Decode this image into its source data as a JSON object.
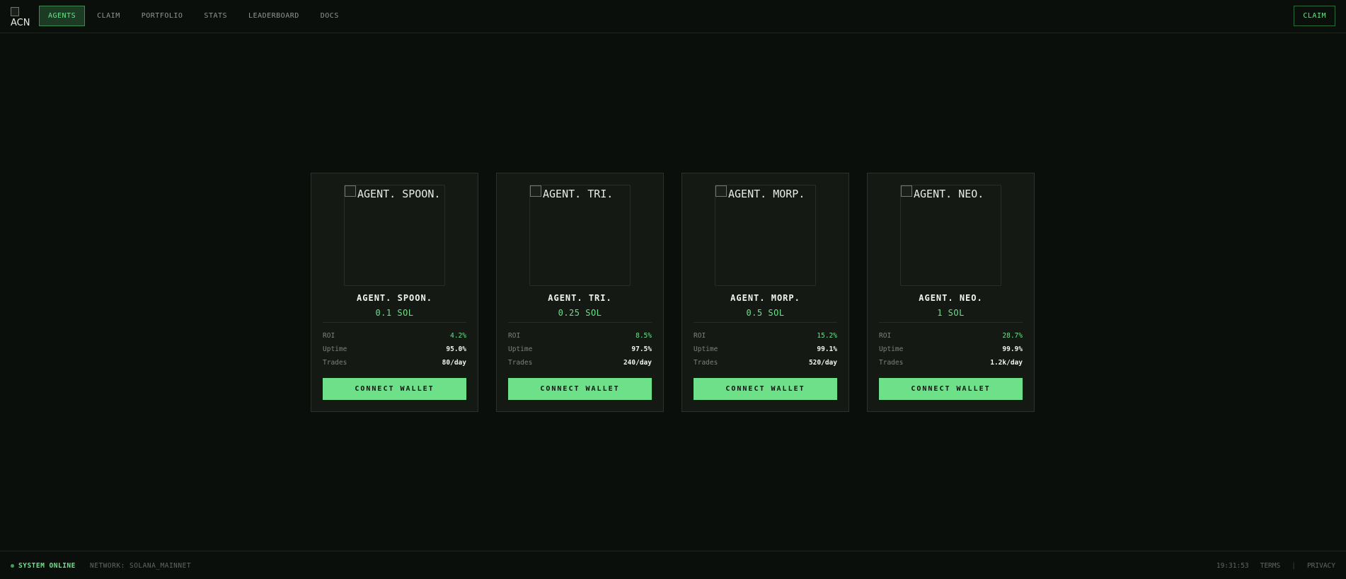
{
  "logo": {
    "alt": "ACN"
  },
  "nav": {
    "items": [
      {
        "label": "AGENTS",
        "active": true
      },
      {
        "label": "CLAIM"
      },
      {
        "label": "PORTFOLIO"
      },
      {
        "label": "STATS"
      },
      {
        "label": "LEADERBOARD"
      },
      {
        "label": "DOCS"
      }
    ],
    "claim_label": "CLAIM"
  },
  "cards": [
    {
      "image_alt": "AGENT. SPOON.",
      "name": "AGENT. SPOON.",
      "price": "0.1 SOL",
      "roi_label": "ROI",
      "roi": "4.2%",
      "uptime_label": "Uptime",
      "uptime": "95.0%",
      "trades_label": "Trades",
      "trades": "80/day",
      "button": "CONNECT WALLET"
    },
    {
      "image_alt": "AGENT. TRI.",
      "name": "AGENT. TRI.",
      "price": "0.25 SOL",
      "roi_label": "ROI",
      "roi": "8.5%",
      "uptime_label": "Uptime",
      "uptime": "97.5%",
      "trades_label": "Trades",
      "trades": "240/day",
      "button": "CONNECT WALLET"
    },
    {
      "image_alt": "AGENT. MORP.",
      "name": "AGENT. MORP.",
      "price": "0.5 SOL",
      "roi_label": "ROI",
      "roi": "15.2%",
      "uptime_label": "Uptime",
      "uptime": "99.1%",
      "trades_label": "Trades",
      "trades": "520/day",
      "button": "CONNECT WALLET"
    },
    {
      "image_alt": "AGENT. NEO.",
      "name": "AGENT. NEO.",
      "price": "1 SOL",
      "roi_label": "ROI",
      "roi": "28.7%",
      "uptime_label": "Uptime",
      "uptime": "99.9%",
      "trades_label": "Trades",
      "trades": "1.2k/day",
      "button": "CONNECT WALLET"
    }
  ],
  "footer": {
    "status": "SYSTEM ONLINE",
    "network": "NETWORK: SOLANA_MAINNET",
    "time": "19:31:53",
    "terms": "TERMS",
    "separator": "|",
    "privacy": "PRIVACY"
  },
  "colors": {
    "background": "#0b0f0b",
    "accent": "#6fe08a",
    "card": "#141914"
  },
  "icons": {
    "status": "status-dot-icon",
    "broken_image": "broken-image-icon"
  }
}
